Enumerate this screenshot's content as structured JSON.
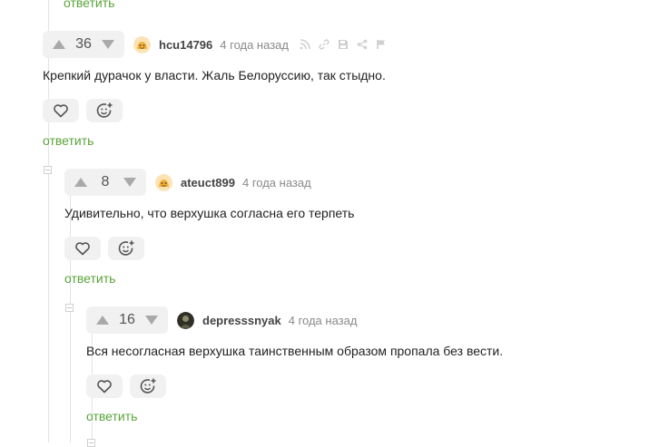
{
  "reply_label": "ответить",
  "colors": {
    "accent": "#5aa33a",
    "tree_line": "#e3e3e3",
    "muted": "#8a8a8a"
  },
  "comments": [
    {
      "rating": "36",
      "author": "hcu14796",
      "time": "4 года назад",
      "avatar_icon": "golden-face-avatar",
      "text": "Крепкий дурачок у власти. Жаль Белоруссию, так стыдно.",
      "tools": [
        "rss-icon",
        "link-icon",
        "save-icon",
        "share-icon",
        "flag-icon"
      ]
    },
    {
      "rating": "8",
      "author": "ateuct899",
      "time": "4 года назад",
      "avatar_icon": "golden-face-avatar",
      "text": "Удивительно, что верхушка согласна его терпеть"
    },
    {
      "rating": "16",
      "author": "depresssnyak",
      "time": "4 года назад",
      "avatar_icon": "photo-avatar",
      "text": "Вся несогласная верхушка таинственным образом пропала без вести."
    }
  ]
}
